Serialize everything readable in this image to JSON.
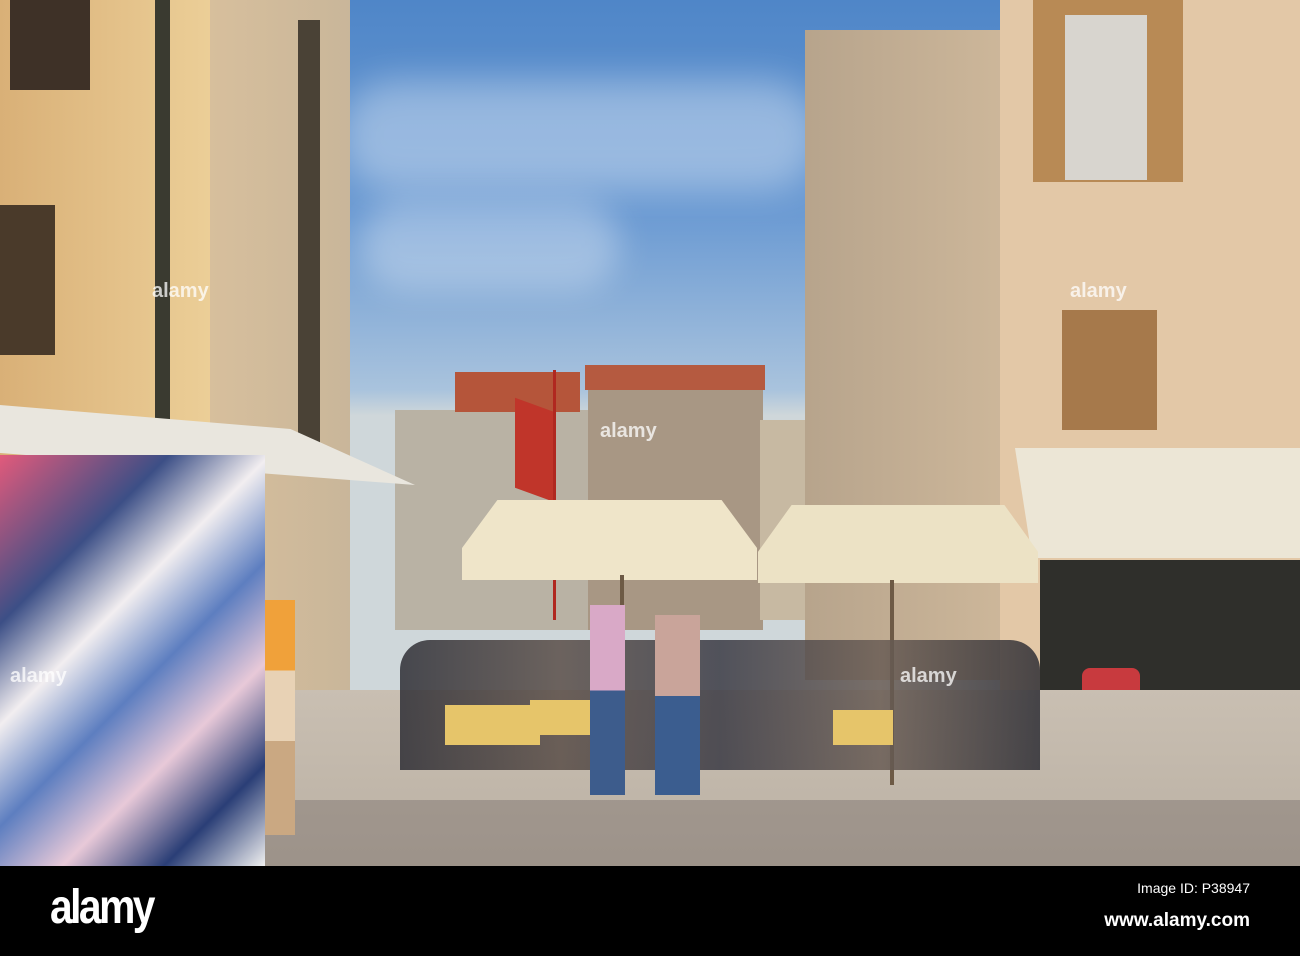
{
  "watermark": {
    "logo": "alamy",
    "image_id": "Image ID: P38947",
    "url": "www.alamy.com"
  },
  "colors": {
    "sky": "#5b8fcf",
    "left_building": "#e8c98f",
    "right_building": "#e2c7a6",
    "umbrella": "#efe4c6",
    "pavement": "#bfb5a8",
    "footer": "#000000"
  }
}
